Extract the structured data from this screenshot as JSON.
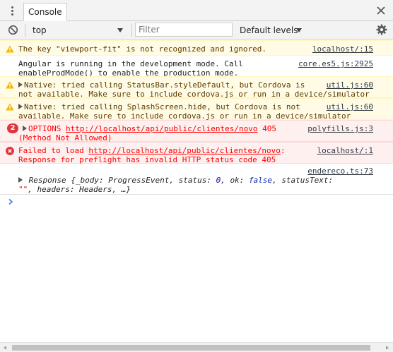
{
  "tabbar": {
    "tab_label": "Console"
  },
  "toolbar": {
    "context": "top",
    "filter_placeholder": "Filter",
    "levels": "Default levels"
  },
  "messages": [
    {
      "level": "warning",
      "text": "The key \"viewport-fit\" is not recognized and ignored.",
      "source": "localhost/:15"
    },
    {
      "level": "info",
      "line1": "Angular is running in the development mode. Call",
      "line2": "enableProdMode() to enable the production mode.",
      "source": "core.es5.js:2925"
    },
    {
      "level": "warning",
      "line1": "Native: tried calling StatusBar.styleDefault, but Cordova is",
      "line2": "not available. Make sure to include cordova.js or run in a device/simulator",
      "source": "util.js:60"
    },
    {
      "level": "warning",
      "line1": "Native: tried calling SplashScreen.hide, but Cordova is not",
      "line2": "available. Make sure to include cordova.js or run in a device/simulator",
      "source": "util.js:60"
    },
    {
      "level": "error",
      "count": "2",
      "method": "OPTIONS",
      "url": "http://localhost/api/public/clientes/novo",
      "status": "405",
      "line2": "(Method Not Allowed)",
      "source": "polyfills.js:3"
    },
    {
      "level": "error",
      "prefix": "Failed to load",
      "url": "http://localhost/api/public/clientes/novo",
      "suffix": ":",
      "line2": "Response for preflight has invalid HTTP status code 405",
      "source": "localhost/:1"
    },
    {
      "level": "log",
      "source": "endereco.ts:73",
      "object": {
        "class": "Response",
        "p1_key": "_body:",
        "p1_val": "ProgressEvent",
        "p2_key": "status:",
        "p2_val": "0",
        "p3_key": "ok:",
        "p3_val": "false",
        "p4_key": "statusText:",
        "p4_val": "\"\"",
        "p5_key": "headers:",
        "p5_val": "Headers",
        "ellipsis": "…}"
      }
    }
  ],
  "colors": {
    "warning_bg": "#fffbe5",
    "error_bg": "#fff0f0",
    "error_text": "#ff0000",
    "warning_text": "#5c3c00",
    "prompt": "#367cf1"
  }
}
